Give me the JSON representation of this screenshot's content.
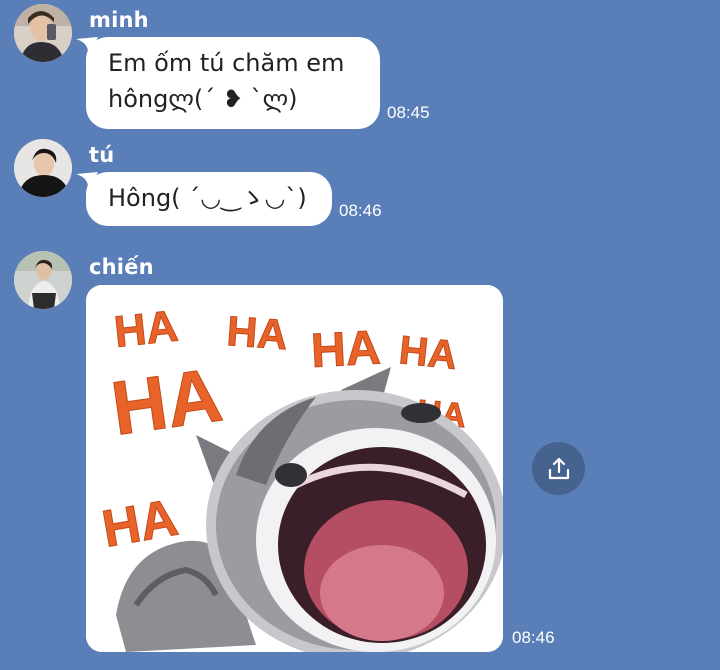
{
  "messages": [
    {
      "sender": "minh",
      "lines": [
        "Em ốm tú chăm em",
        "hôngლ(´ ❥ `ლ)"
      ],
      "time": "08:45"
    },
    {
      "sender": "tú",
      "lines": [
        "Hông( ´◡‿ゝ◡`)"
      ],
      "time": "08:46"
    },
    {
      "sender": "chiến",
      "sticker": {
        "texts": [
          "HA",
          "HA",
          "HA",
          "HA",
          "HA",
          "HA",
          "HA"
        ],
        "icon": "laughing-cat-sticker"
      },
      "time": "08:46"
    }
  ],
  "share_icon": "share-upload-icon",
  "colors": {
    "background": "#5a7fb8",
    "bubble": "#ffffff",
    "share_button": "#46628f",
    "ha_text": "#e8632a"
  }
}
